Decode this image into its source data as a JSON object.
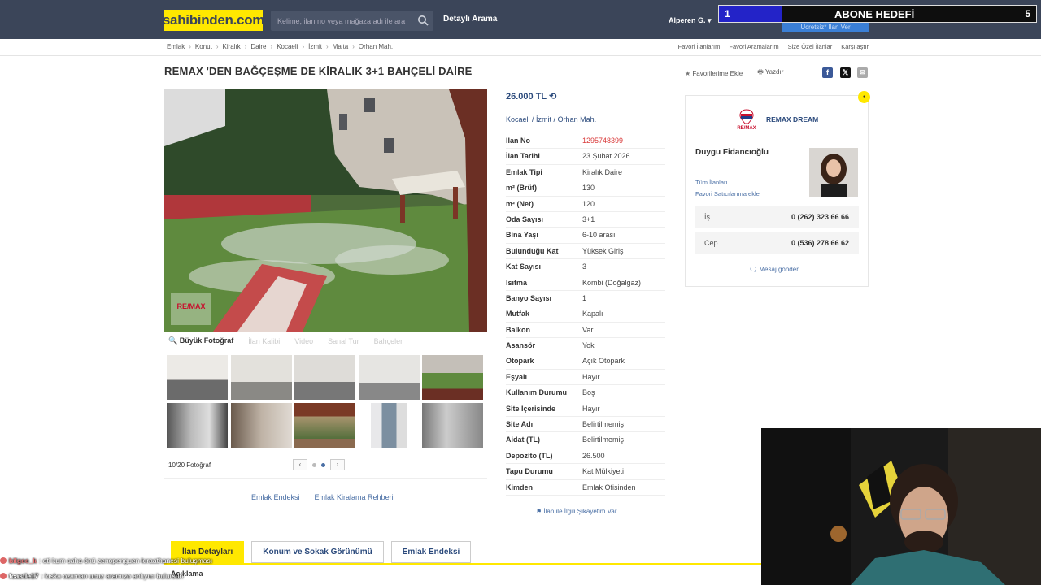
{
  "header": {
    "logo": "sahibinden.com",
    "search_placeholder": "Kelime, ilan no veya mağaza adı ile ara",
    "detailed_search": "Detaylı Arama",
    "user": "Alperen G. ▾",
    "ghost_button": "Ücretsiz* İlan Ver"
  },
  "overlay_goal": {
    "start": "1",
    "title": "ABONE HEDEFİ",
    "end": "5",
    "progress": 0.2,
    "fill_color": "#2323c8"
  },
  "breadcrumb": [
    "Emlak",
    "Konut",
    "Kiralık",
    "Daire",
    "Kocaeli",
    "İzmit",
    "Malta",
    "Orhan Mah."
  ],
  "top_links": [
    "Favori İlanlarım",
    "Favori Aramalarım",
    "Size Özel İlanlar",
    "Karşılaştır"
  ],
  "listing": {
    "title": "REMAX 'DEN BAĞÇEŞME DE KİRALIK 3+1 BAHÇELİ DAİRE",
    "favorite": "Favorilerime Ekle",
    "print": "Yazdır",
    "price": "26.000 TL",
    "location": [
      "Kocaeli",
      "İzmit",
      "Orhan Mah."
    ]
  },
  "photo_tools": {
    "big_photo": "Büyük Fotoğraf",
    "muted": [
      "İlan Kalibi",
      "Video",
      "Sanal Tur",
      "Bahçeler"
    ]
  },
  "gallery": {
    "count": "10/20 Fotoğraf"
  },
  "left_links": [
    "Emlak Endeksi",
    "Emlak Kiralama Rehberi"
  ],
  "specs": [
    {
      "k": "İlan No",
      "v": "1295748399"
    },
    {
      "k": "İlan Tarihi",
      "v": "23 Şubat 2026"
    },
    {
      "k": "Emlak Tipi",
      "v": "Kiralık Daire"
    },
    {
      "k": "m² (Brüt)",
      "v": "130"
    },
    {
      "k": "m² (Net)",
      "v": "120"
    },
    {
      "k": "Oda Sayısı",
      "v": "3+1"
    },
    {
      "k": "Bina Yaşı",
      "v": "6-10 arası"
    },
    {
      "k": "Bulunduğu Kat",
      "v": "Yüksek Giriş"
    },
    {
      "k": "Kat Sayısı",
      "v": "3"
    },
    {
      "k": "Isıtma",
      "v": "Kombi (Doğalgaz)"
    },
    {
      "k": "Banyo Sayısı",
      "v": "1"
    },
    {
      "k": "Mutfak",
      "v": "Kapalı"
    },
    {
      "k": "Balkon",
      "v": "Var"
    },
    {
      "k": "Asansör",
      "v": "Yok"
    },
    {
      "k": "Otopark",
      "v": "Açık Otopark"
    },
    {
      "k": "Eşyalı",
      "v": "Hayır"
    },
    {
      "k": "Kullanım Durumu",
      "v": "Boş"
    },
    {
      "k": "Site İçerisinde",
      "v": "Hayır"
    },
    {
      "k": "Site Adı",
      "v": "Belirtilmemiş"
    },
    {
      "k": "Aidat (TL)",
      "v": "Belirtilmemiş"
    },
    {
      "k": "Depozito (TL)",
      "v": "26.500"
    },
    {
      "k": "Tapu Durumu",
      "v": "Kat Mülkiyeti"
    },
    {
      "k": "Kimden",
      "v": "Emlak Ofisinden"
    }
  ],
  "complaint": "İlan ile İlgili Şikayetim Var",
  "seller": {
    "agency": "REMAX DREAM",
    "agent": "Duygu Fidancıoğlu",
    "links": [
      "Tüm İlanları",
      "Favori Satıcılarıma ekle"
    ],
    "phones": [
      {
        "k": "İş",
        "v": "0 (262) 323 66 66"
      },
      {
        "k": "Cep",
        "v": "0 (536) 278 66 62"
      }
    ],
    "message": "Mesaj gönder"
  },
  "tabs": [
    "İlan Detayları",
    "Konum ve Sokak Görünümü",
    "Emlak Endeksi"
  ],
  "description_label": "Açıklama",
  "chat": [
    {
      "nick": "bilgee_k",
      "msg": ": eti kum saha önü zenopenguen kıraathanesi buluşması"
    },
    {
      "nick": "fcastle17",
      "msg": ": kıska ozaman ucuz aramızo anlıyıcı bulursun"
    }
  ],
  "colors": {
    "brand_yellow": "#ffe800",
    "topbar": "#3b4559",
    "link": "#4a6fa5",
    "red": "#d93a3a"
  }
}
